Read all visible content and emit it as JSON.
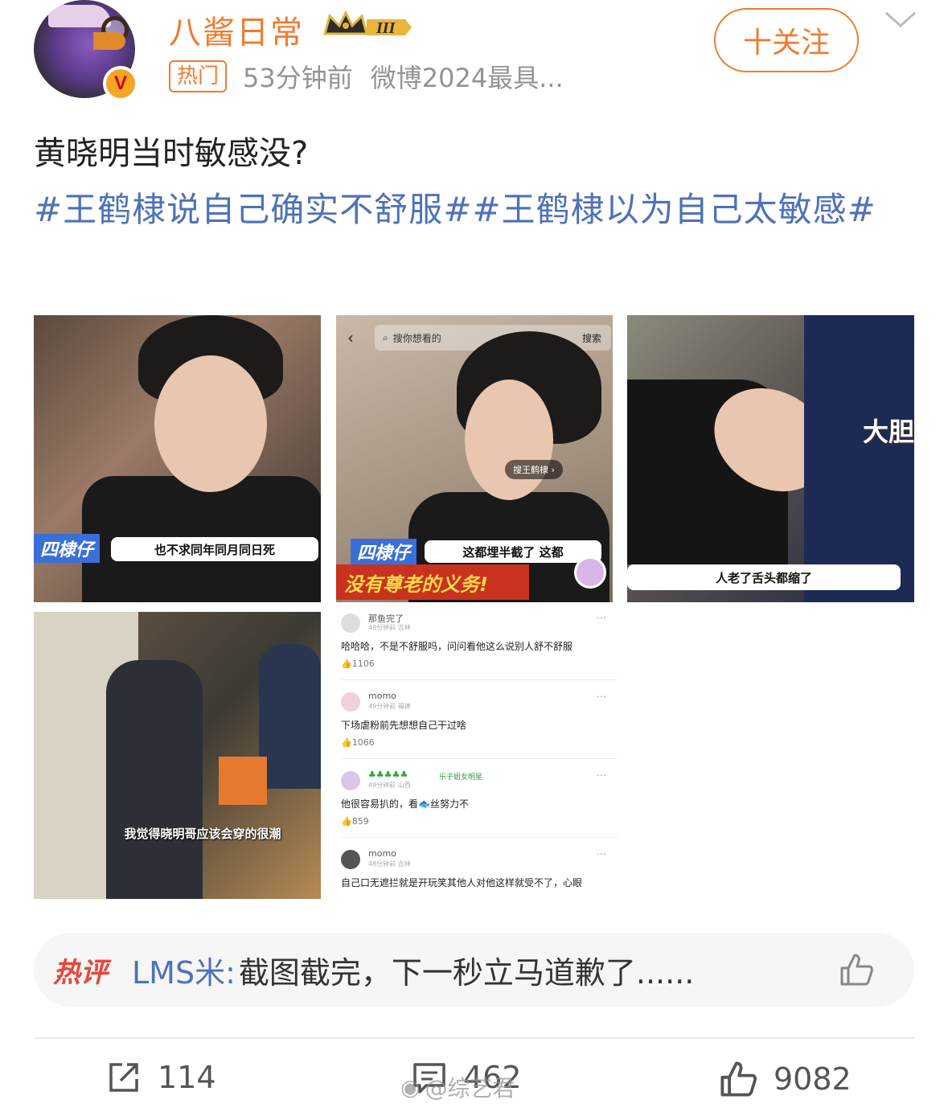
{
  "header": {
    "username": "八酱日常",
    "level_badge": "III",
    "hot_tag": "热门",
    "time": "53分钟前",
    "source": "微博2024最具...",
    "follow_label": "十关注"
  },
  "post": {
    "text": "黄晓明当时敏感没?",
    "hashtags": "#王鹤棣说自己确实不舒服##王鹤棣以为自己太敏感#"
  },
  "images": {
    "img1": {
      "tag": "四棣仔",
      "subtitle": "也不求同年同月同日死"
    },
    "img2": {
      "search_placeholder": "搜你想看的",
      "search_button": "搜索",
      "pill": "搜王鹤棣 ›",
      "tag": "四棣仔",
      "subtitle": "这都埋半截了 这都",
      "banner": "没有尊老的义务!"
    },
    "img3": {
      "big_text": "大胆",
      "subtitle": "人老了舌头都缩了"
    },
    "img4": {
      "subtitle": "我觉得晓明哥应该会穿的很潮"
    },
    "comments": [
      {
        "name": "那鱼完了",
        "meta": "49分钟前 吉林",
        "text": "哈哈哈，不是不舒服吗，问问看他这么说别人舒不舒服",
        "likes": "1106"
      },
      {
        "name": "momo",
        "meta": "49分钟前 福建",
        "text": "下场虐粉前先想想自己干过啥",
        "likes": "1066"
      },
      {
        "name": "♣♣♣♣♣",
        "meta": "49分钟前 山西",
        "badge": "乐子姐女明星",
        "text": "他很容易扒的，看🐟丝努力不",
        "likes": "859"
      },
      {
        "name": "momo",
        "meta": "48分钟前 吉林",
        "text": "自己口无遮拦就是开玩笑其他人对他这样就受不了，心眼",
        "likes": ""
      }
    ]
  },
  "hot_comment": {
    "label": "热评",
    "user": "LMS米:",
    "text": "截图截完，下一秒立马道歉了......"
  },
  "actions": {
    "repost_count": "114",
    "comment_count": "462",
    "like_count": "9082"
  },
  "watermark": "@综艺君",
  "colors": {
    "accent": "#f07b2f",
    "link": "#4e72b8",
    "hot_red": "#e8463a"
  }
}
